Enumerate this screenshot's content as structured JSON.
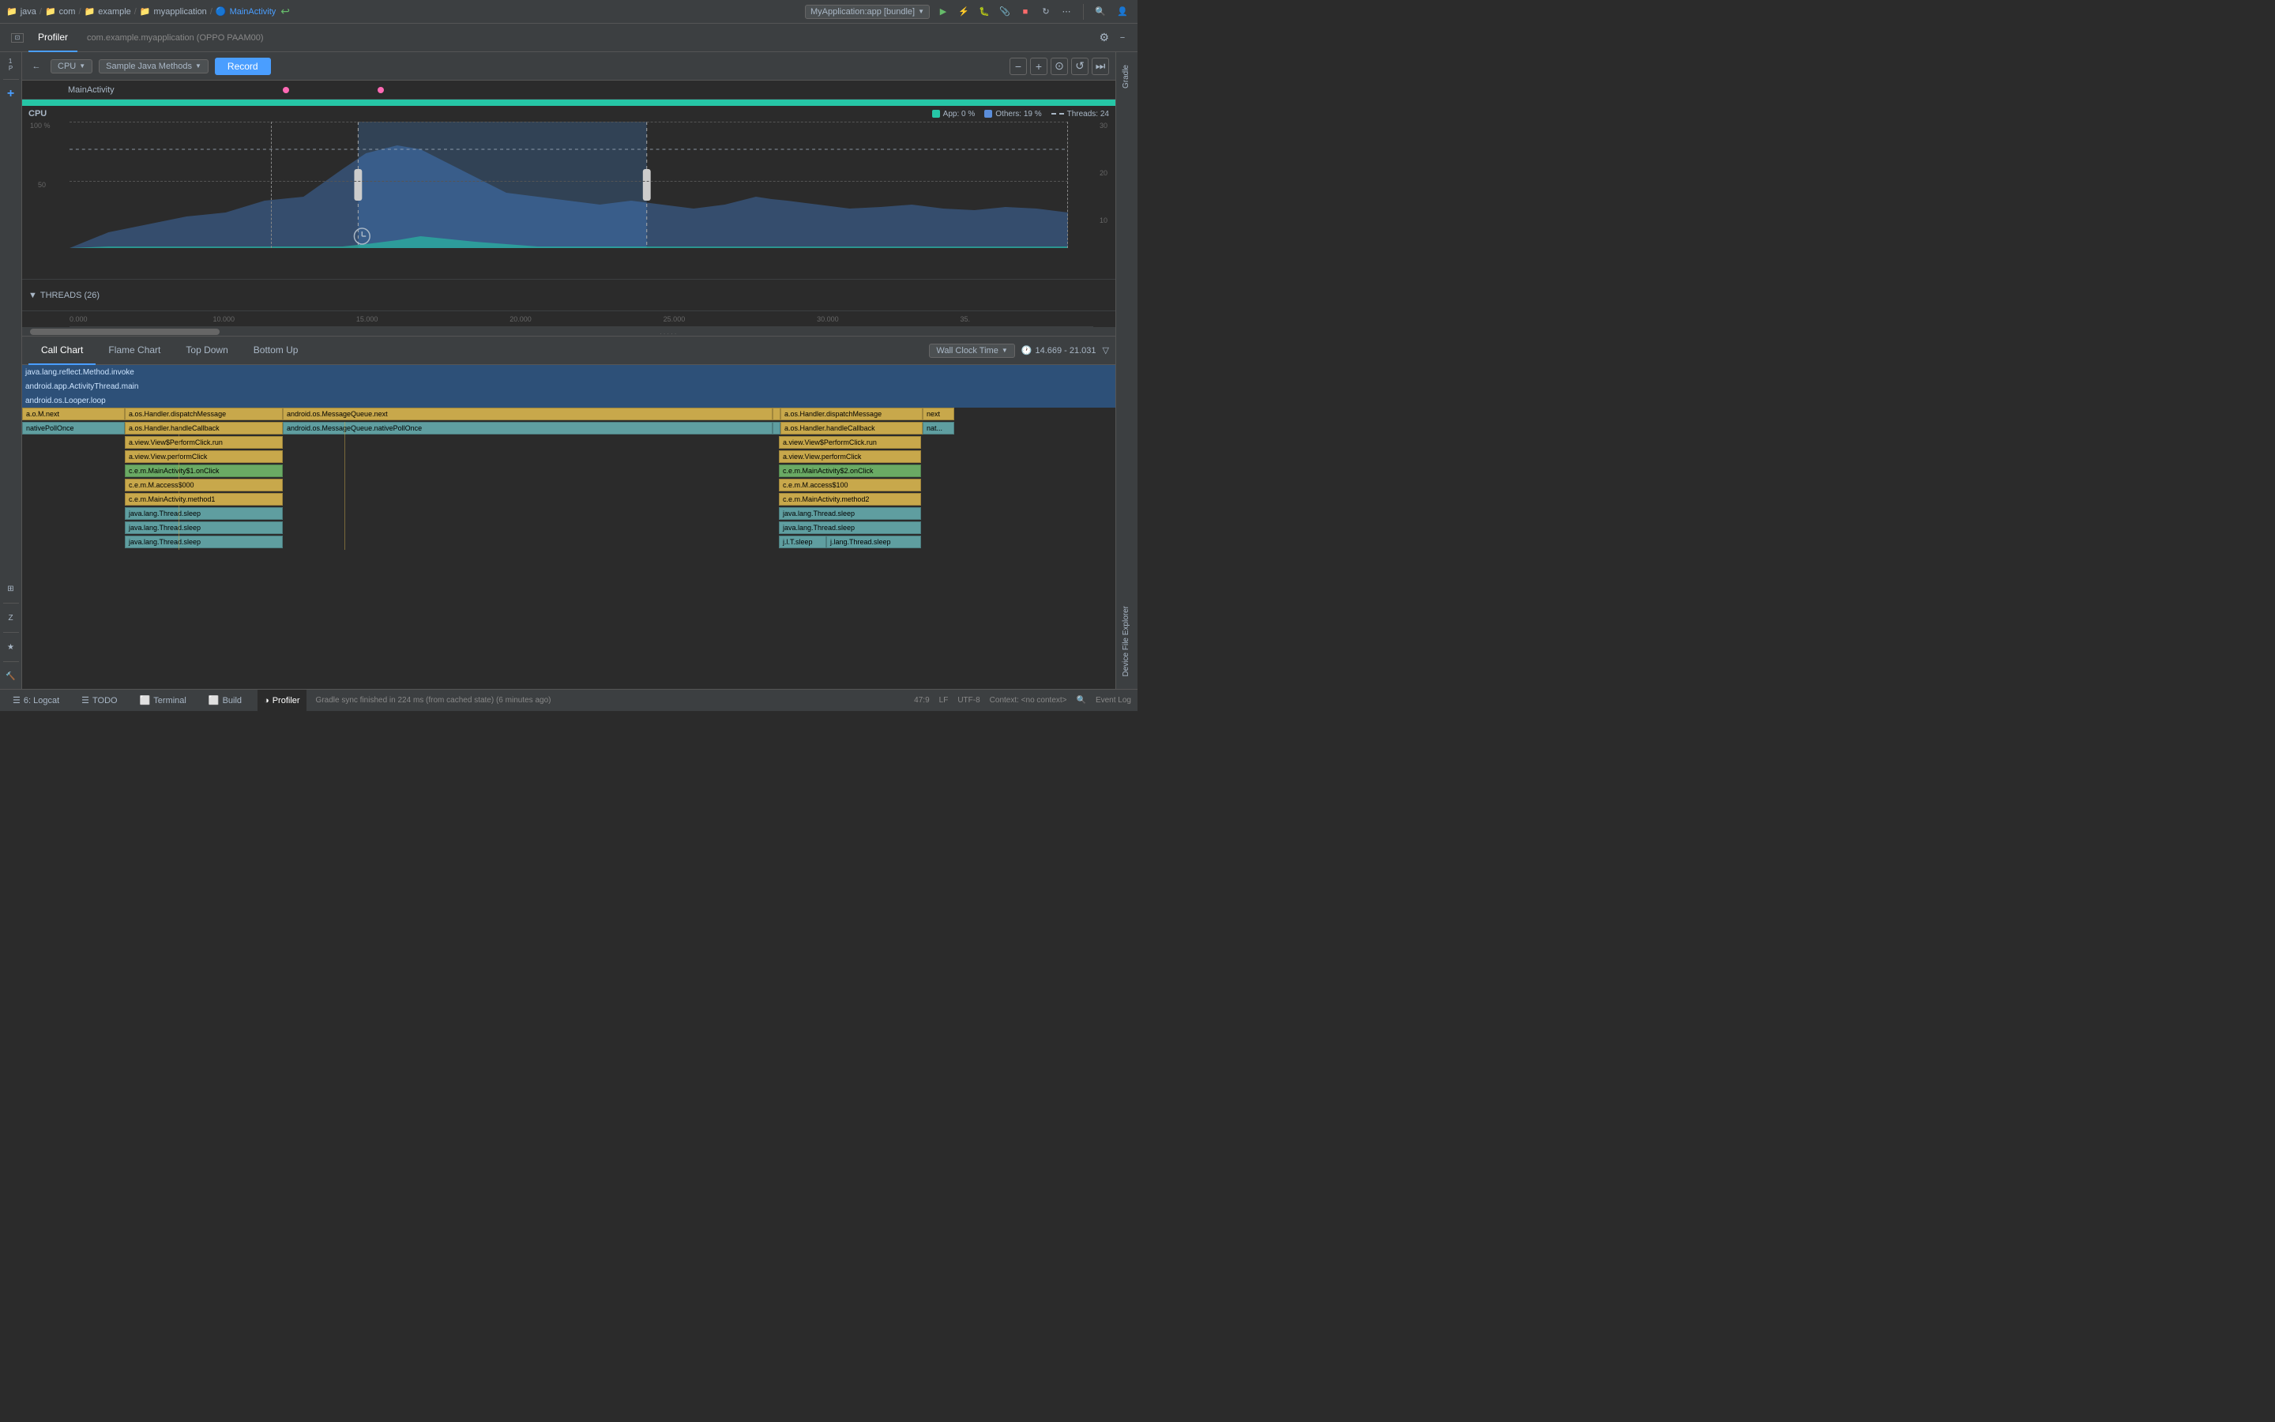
{
  "toolbar": {
    "breadcrumbs": [
      "java",
      "com",
      "example",
      "myapplication",
      "MainActivity"
    ],
    "app_selector": "MyApplication:app [bundle]",
    "back_icon": "◀",
    "run_icon": "▶",
    "lightning_icon": "⚡"
  },
  "profiler_bar": {
    "tab": "Profiler",
    "subtitle": "com.example.myapplication (OPPO PAAM00)",
    "gear_icon": "⚙",
    "minus_icon": "−"
  },
  "profiler_header": {
    "back": "←",
    "cpu_label": "CPU",
    "method_label": "Sample Java Methods",
    "record_label": "Record",
    "zoom_minus": "−",
    "zoom_plus": "+",
    "fit_icon": "⊙",
    "reset_icon": "↺",
    "end_icon": "⏭"
  },
  "timeline": {
    "main_activity": "MainActivity",
    "cpu_label": "CPU",
    "percent_100": "100 %",
    "percent_50": "50",
    "threads_count": "THREADS (26)",
    "x_labels": [
      "0.000",
      "10.000",
      "15.000",
      "20.000",
      "25.000",
      "30.000",
      "35."
    ],
    "x_positions": [
      6,
      20,
      33,
      47,
      61,
      75,
      87
    ],
    "app_label": "App: 0 %",
    "others_label": "Others: 19 %",
    "threads_label": "Threads: 24",
    "time_range": "14.669 - 21.031"
  },
  "analysis": {
    "tabs": [
      "Call Chart",
      "Flame Chart",
      "Top Down",
      "Bottom Up"
    ],
    "active_tab": "Call Chart",
    "wall_clock": "Wall Clock Time",
    "time_range": "14.669 - 21.031",
    "clock_icon": "🕐",
    "filter_icon": "▽"
  },
  "call_chart": {
    "rows": [
      {
        "label": "java.lang.reflect.Method.invoke",
        "color": "#3e6896",
        "indent": 0,
        "width_pct": 70
      },
      {
        "label": "android.app.ActivityThread.main",
        "color": "#3e6896",
        "indent": 0,
        "width_pct": 70
      },
      {
        "label": "android.os.Looper.loop",
        "color": "#3e6896",
        "indent": 0,
        "width_pct": 70
      }
    ],
    "method_rows": [
      {
        "col1": "a.o.M.next",
        "col1_color": "#c8a84b",
        "col2": "a.os.Handler.dispatchMessage",
        "col2_color": "#c8a84b",
        "col3": "android.os.MessageQueue.next",
        "col3_color": "#c8a84b",
        "col4": "a.os.Handler.dispatchMessage",
        "col4_color": "#c8a84b",
        "col5": "next"
      },
      {
        "col1": "nativePollOnce",
        "col1_color": "#5f9ea0",
        "col2": "a.os.Handler.handleCallback",
        "col2_color": "#c8a84b",
        "col3": "android.os.MessageQueue.nativePollOnce",
        "col3_color": "#5f9ea0",
        "col4": "a.os.Handler.handleCallback",
        "col4_color": "#c8a84b",
        "col5": "nat..."
      }
    ],
    "detail_rows": [
      {
        "label": "a.view.View$PerformClick.run",
        "color": "#c8a84b"
      },
      {
        "label": "a.view.View.performClick",
        "color": "#c8a84b"
      },
      {
        "label": "c.e.m.MainActivity$1.onClick",
        "color": "#6aaa64"
      },
      {
        "label": "c.e.m.M.access$000",
        "color": "#c8a84b"
      },
      {
        "label": "c.e.m.MainActivity.method1",
        "color": "#c8a84b"
      },
      {
        "label": "java.lang.Thread.sleep",
        "color": "#5f9ea0"
      },
      {
        "label": "java.lang.Thread.sleep",
        "color": "#5f9ea0"
      },
      {
        "label": "java.lang.Thread.sleep",
        "color": "#5f9ea0"
      }
    ],
    "detail_rows2": [
      {
        "label": "a.view.View$PerformClick.run",
        "color": "#c8a84b"
      },
      {
        "label": "a.view.View.performClick",
        "color": "#c8a84b"
      },
      {
        "label": "c.e.m.MainActivity$2.onClick",
        "color": "#6aaa64"
      },
      {
        "label": "c.e.m.M.access$100",
        "color": "#c8a84b"
      },
      {
        "label": "c.e.m.MainActivity.method2",
        "color": "#c8a84b"
      },
      {
        "label": "java.lang.Thread.sleep",
        "color": "#5f9ea0"
      },
      {
        "label": "java.lang.Thread.sleep",
        "color": "#5f9ea0"
      },
      {
        "label": "j.l.T.sleep",
        "color": "#5f9ea0"
      }
    ]
  },
  "status_bar": {
    "logcat": "6: Logcat",
    "todo": "TODO",
    "terminal": "Terminal",
    "build": "Build",
    "profiler": "Profiler",
    "event_log": "Event Log",
    "status_msg": "Gradle sync finished in 224 ms (from cached state) (6 minutes ago)",
    "cursor_pos": "47:9",
    "line_ending": "LF",
    "encoding": "UTF-8",
    "context": "Context: <no context>"
  },
  "right_sidebar": {
    "gradle": "Gradle",
    "device_file": "Device File Explorer"
  },
  "left_sidebar": {
    "project_icon": "P",
    "add_icon": "+",
    "layout_icon": "⊞",
    "structure_icon": "≡",
    "favorites_icon": "★",
    "build_icon": "🔨"
  }
}
